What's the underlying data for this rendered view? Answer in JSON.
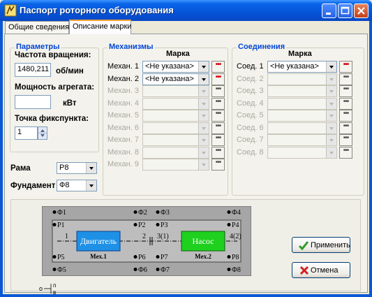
{
  "window": {
    "title": "Паспорт роторного оборудования",
    "controls": [
      "minimize",
      "maximize",
      "close"
    ]
  },
  "tabs": [
    {
      "label": "Общие сведения",
      "active": false
    },
    {
      "label": "Описание марки",
      "active": true
    }
  ],
  "params": {
    "legend": "Параметры",
    "speed_label": "Частота вращения:",
    "speed_value": "1480,211",
    "speed_unit": "об/мин",
    "power_label": "Мощность агрегата:",
    "power_value": "",
    "power_unit": "кВт",
    "fixpoint_label": "Точка фикспункта:",
    "fixpoint_value": "1"
  },
  "frame": {
    "label": "Рама",
    "value": "Р8"
  },
  "foundation": {
    "label": "Фундамент",
    "value": "Ф8"
  },
  "mechanisms": {
    "legend": "Механизмы",
    "column": "Марка",
    "rows": [
      {
        "label": "Механ. 1",
        "value": "<Не указана>",
        "enabled": true,
        "dots": "•••"
      },
      {
        "label": "Механ. 2",
        "value": "<Не указана>",
        "enabled": true,
        "dots": "•••"
      },
      {
        "label": "Механ. 3",
        "value": "",
        "enabled": false,
        "dots": "•••"
      },
      {
        "label": "Механ. 4",
        "value": "",
        "enabled": false,
        "dots": "•••"
      },
      {
        "label": "Механ. 5",
        "value": "",
        "enabled": false,
        "dots": "•••"
      },
      {
        "label": "Механ. 6",
        "value": "",
        "enabled": false,
        "dots": "•••"
      },
      {
        "label": "Механ. 7",
        "value": "",
        "enabled": false,
        "dots": "•••"
      },
      {
        "label": "Механ. 8",
        "value": "",
        "enabled": false,
        "dots": "•••"
      },
      {
        "label": "Механ. 9",
        "value": "",
        "enabled": false,
        "dots": "•••"
      }
    ]
  },
  "connections": {
    "legend": "Соединения",
    "column": "Марка",
    "rows": [
      {
        "label": "Соед. 1",
        "value": "<Не указана>",
        "enabled": true,
        "dots": "•••"
      },
      {
        "label": "Соед. 2",
        "value": "",
        "enabled": false,
        "dots": "•••"
      },
      {
        "label": "Соед. 3",
        "value": "",
        "enabled": false,
        "dots": "•••"
      },
      {
        "label": "Соед. 4",
        "value": "",
        "enabled": false,
        "dots": "•••"
      },
      {
        "label": "Соед. 5",
        "value": "",
        "enabled": false,
        "dots": "•••"
      },
      {
        "label": "Соед. 6",
        "value": "",
        "enabled": false,
        "dots": "•••"
      },
      {
        "label": "Соед. 7",
        "value": "",
        "enabled": false,
        "dots": "•••"
      },
      {
        "label": "Соед. 8",
        "value": "",
        "enabled": false,
        "dots": "•••"
      }
    ]
  },
  "scheme": {
    "top_outer": [
      "Ф1",
      "Ф2",
      "Ф3",
      "Ф4"
    ],
    "top_inner": [
      "Р1",
      "Р2",
      "Р3",
      "Р4"
    ],
    "bottom_inner": [
      "Р5",
      "Р6",
      "Р7",
      "Р8"
    ],
    "bottom_outer": [
      "Ф5",
      "Ф6",
      "Ф7",
      "Ф8"
    ],
    "mech1": {
      "name": "Двигатель",
      "caption": "Mex.1",
      "color": "#1e90e6"
    },
    "mech2": {
      "name": "Насос",
      "caption": "Mex.2",
      "color": "#1fd01f"
    },
    "shaft_labels": [
      "1",
      "2",
      "3(1)",
      "4(2)"
    ],
    "axis_labels": [
      "о",
      "п",
      "в"
    ]
  },
  "actions": {
    "apply": "Применить",
    "cancel": "Отмена"
  },
  "colors": {
    "title_bar": "#0a58d6",
    "legend_text": "#0046d5",
    "apply_icon": "#2f9a2a",
    "cancel_icon": "#d02121"
  }
}
